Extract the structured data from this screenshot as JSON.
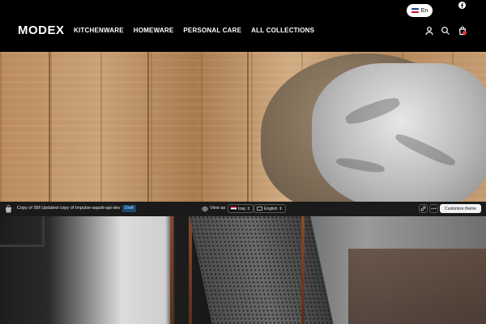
{
  "store": {
    "logo": "MODEX"
  },
  "top_bar": {
    "language": "En",
    "flag_icon": "uk-flag-icon",
    "social_icon": "facebook-icon"
  },
  "nav": {
    "items": [
      "KITCHENWARE",
      "HOMEWARE",
      "PERSONAL CARE",
      "ALL COLLECTIONS"
    ]
  },
  "header_icons": [
    "account-icon",
    "search-icon",
    "cart-icon"
  ],
  "hero": {
    "image": "wood-floor-with-woven-basket"
  },
  "admin_bar": {
    "theme_name": "Copy of SM Updated copy of Impulse-aqasti-api-dev",
    "status_badge": "Draft",
    "view_as_label": "View as",
    "country": "Iraq",
    "language": "English",
    "customize_label": "Customize theme"
  },
  "lower_image": {
    "image": "dark-mesh-space-heater"
  },
  "colors": {
    "header_bg": "#000000",
    "admin_bar_bg": "#1a1a1a",
    "draft_badge": "#1a4a73",
    "cart_badge": "#e33333"
  }
}
